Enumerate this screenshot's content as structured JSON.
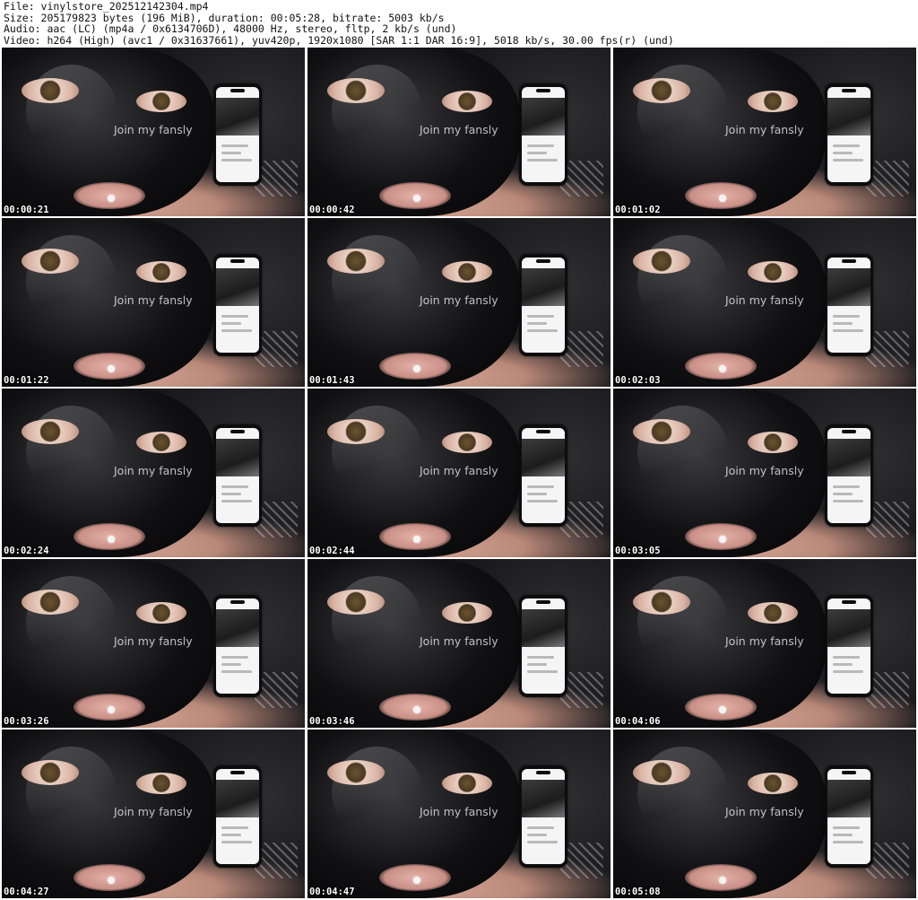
{
  "header": {
    "file_line": "File: vinylstore_202512142304.mp4",
    "size_line": "Size: 205179823 bytes (196 MiB), duration: 00:05:28, bitrate: 5003 kb/s",
    "audio_line": "Audio: aac (LC) (mp4a / 0x6134706D), 48000 Hz, stereo, fltp, 2 kb/s (und)",
    "video_line": "Video: h264 (High) (avc1 / 0x31637661), yuv420p, 1920x1080 [SAR 1:1 DAR 16:9], 5018 kb/s, 30.00 fps(r) (und)"
  },
  "watermark_text": "Join my fansly",
  "frames": [
    {
      "timestamp": "00:00:21",
      "watermark": "Join my fansly"
    },
    {
      "timestamp": "00:00:42",
      "watermark": "Join my fansly"
    },
    {
      "timestamp": "00:01:02",
      "watermark": "Join my fansly"
    },
    {
      "timestamp": "00:01:22",
      "watermark": "Join my fansly"
    },
    {
      "timestamp": "00:01:43",
      "watermark": "Join my fansly"
    },
    {
      "timestamp": "00:02:03",
      "watermark": "Join my fansly"
    },
    {
      "timestamp": "00:02:24",
      "watermark": "Join my fansly"
    },
    {
      "timestamp": "00:02:44",
      "watermark": "Join my fansly"
    },
    {
      "timestamp": "00:03:05",
      "watermark": "Join my fansly"
    },
    {
      "timestamp": "00:03:26",
      "watermark": "Join my fansly"
    },
    {
      "timestamp": "00:03:46",
      "watermark": "Join my fansly"
    },
    {
      "timestamp": "00:04:06",
      "watermark": "Join my fansly"
    },
    {
      "timestamp": "00:04:27",
      "watermark": "Join my fansly"
    },
    {
      "timestamp": "00:04:47",
      "watermark": "Join my fansly"
    },
    {
      "timestamp": "00:05:08",
      "watermark": "Join my fansly"
    }
  ]
}
